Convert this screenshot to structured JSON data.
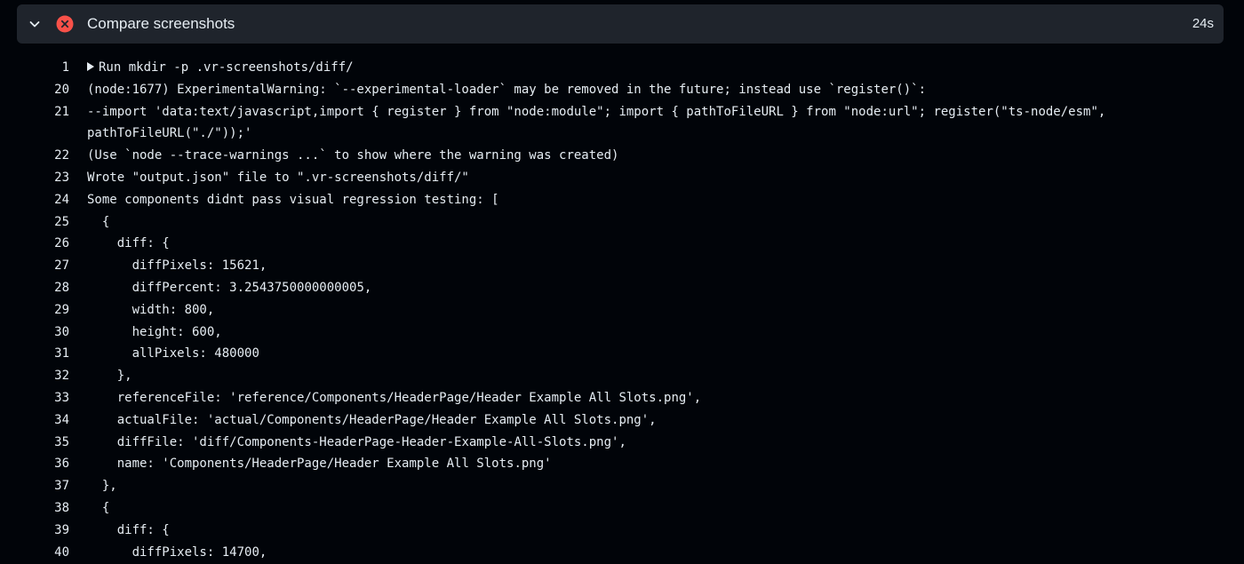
{
  "step": {
    "title": "Compare screenshots",
    "duration": "24s",
    "status": "failed",
    "colors": {
      "failed_icon": "#f85149",
      "header_bg": "#1f242c",
      "page_bg": "#010409",
      "text": "#e6edf3"
    },
    "icons": {
      "collapse": "chevron-down-icon",
      "status": "x-circle-icon",
      "expand_group": "triangle-right-icon"
    }
  },
  "log": [
    {
      "n": "1",
      "text": "Run mkdir -p .vr-screenshots/diff/"
    },
    {
      "n": "20",
      "text": "(node:1677) ExperimentalWarning: `--experimental-loader` may be removed in the future; instead use `register()`:"
    },
    {
      "n": "21",
      "text": "--import 'data:text/javascript,import { register } from \"node:module\"; import { pathToFileURL } from \"node:url\"; register(\"ts-node/esm\",\npathToFileURL(\"./\"));'"
    },
    {
      "n": "22",
      "text": "(Use `node --trace-warnings ...` to show where the warning was created)"
    },
    {
      "n": "23",
      "text": "Wrote \"output.json\" file to \".vr-screenshots/diff/\""
    },
    {
      "n": "24",
      "text": "Some components didnt pass visual regression testing: ["
    },
    {
      "n": "25",
      "text": "  {"
    },
    {
      "n": "26",
      "text": "    diff: {"
    },
    {
      "n": "27",
      "text": "      diffPixels: 15621,"
    },
    {
      "n": "28",
      "text": "      diffPercent: 3.2543750000000005,"
    },
    {
      "n": "29",
      "text": "      width: 800,"
    },
    {
      "n": "30",
      "text": "      height: 600,"
    },
    {
      "n": "31",
      "text": "      allPixels: 480000"
    },
    {
      "n": "32",
      "text": "    },"
    },
    {
      "n": "33",
      "text": "    referenceFile: 'reference/Components/HeaderPage/Header Example All Slots.png',"
    },
    {
      "n": "34",
      "text": "    actualFile: 'actual/Components/HeaderPage/Header Example All Slots.png',"
    },
    {
      "n": "35",
      "text": "    diffFile: 'diff/Components-HeaderPage-Header-Example-All-Slots.png',"
    },
    {
      "n": "36",
      "text": "    name: 'Components/HeaderPage/Header Example All Slots.png'"
    },
    {
      "n": "37",
      "text": "  },"
    },
    {
      "n": "38",
      "text": "  {"
    },
    {
      "n": "39",
      "text": "    diff: {"
    },
    {
      "n": "40",
      "text": "      diffPixels: 14700,"
    }
  ]
}
